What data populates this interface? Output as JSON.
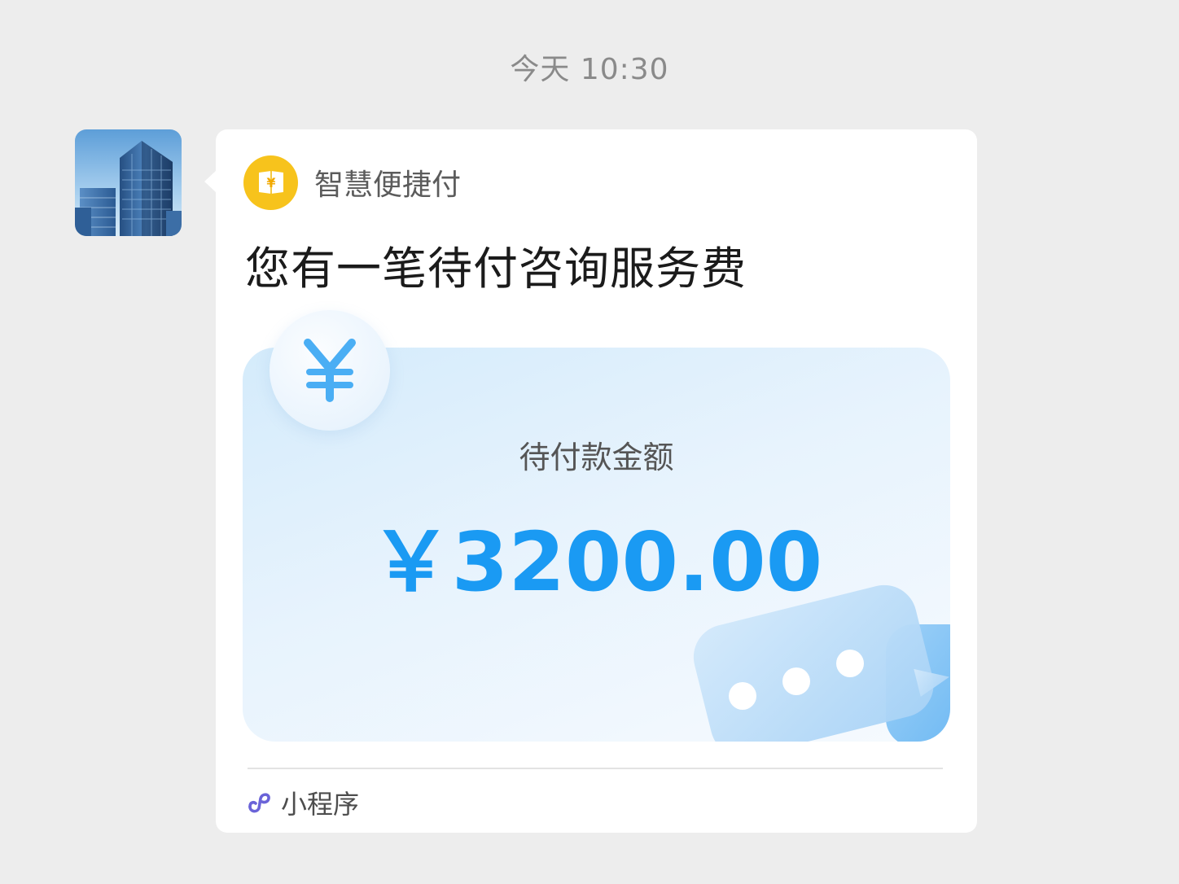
{
  "timestamp": "今天 10:30",
  "sender": {
    "avatar_icon": "building-photo"
  },
  "card": {
    "app_icon": "yen-wallet-icon",
    "app_name": "智慧便捷付",
    "title": "您有一笔待付咨询服务费",
    "amount_label": "待付款金额",
    "amount": "￥3200.00",
    "badge_icon": "yen-icon",
    "decoration_icon": "chat-bubble-icon",
    "footer_icon": "mini-program-icon",
    "footer_label": "小程序"
  },
  "colors": {
    "background": "#ededed",
    "card": "#ffffff",
    "accent_blue": "#1a9af3",
    "app_icon_yellow": "#f7c31c"
  }
}
